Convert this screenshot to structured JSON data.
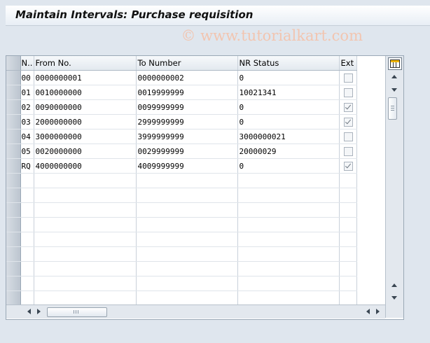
{
  "window": {
    "title": "Maintain Intervals: Purchase requisition"
  },
  "watermark": "© www.tutorialkart.com",
  "grid": {
    "columns": [
      "N..",
      "From No.",
      "To Number",
      "NR Status",
      "Ext"
    ],
    "rows": [
      {
        "n": "00",
        "from": "0000000001",
        "to": "0000000002",
        "status": "0",
        "ext": false
      },
      {
        "n": "01",
        "from": "0010000000",
        "to": "0019999999",
        "status": "10021341",
        "ext": false
      },
      {
        "n": "02",
        "from": "0090000000",
        "to": "0099999999",
        "status": "0",
        "ext": true
      },
      {
        "n": "03",
        "from": "2000000000",
        "to": "2999999999",
        "status": "0",
        "ext": true
      },
      {
        "n": "04",
        "from": "3000000000",
        "to": "3999999999",
        "status": "3000000021",
        "ext": false
      },
      {
        "n": "05",
        "from": "0020000000",
        "to": "0029999999",
        "status": "20000029",
        "ext": false
      },
      {
        "n": "RQ",
        "from": "4000000000",
        "to": "4009999999",
        "status": "0",
        "ext": true
      }
    ],
    "empty_rows": 9,
    "config_icon": "table-settings-icon"
  }
}
